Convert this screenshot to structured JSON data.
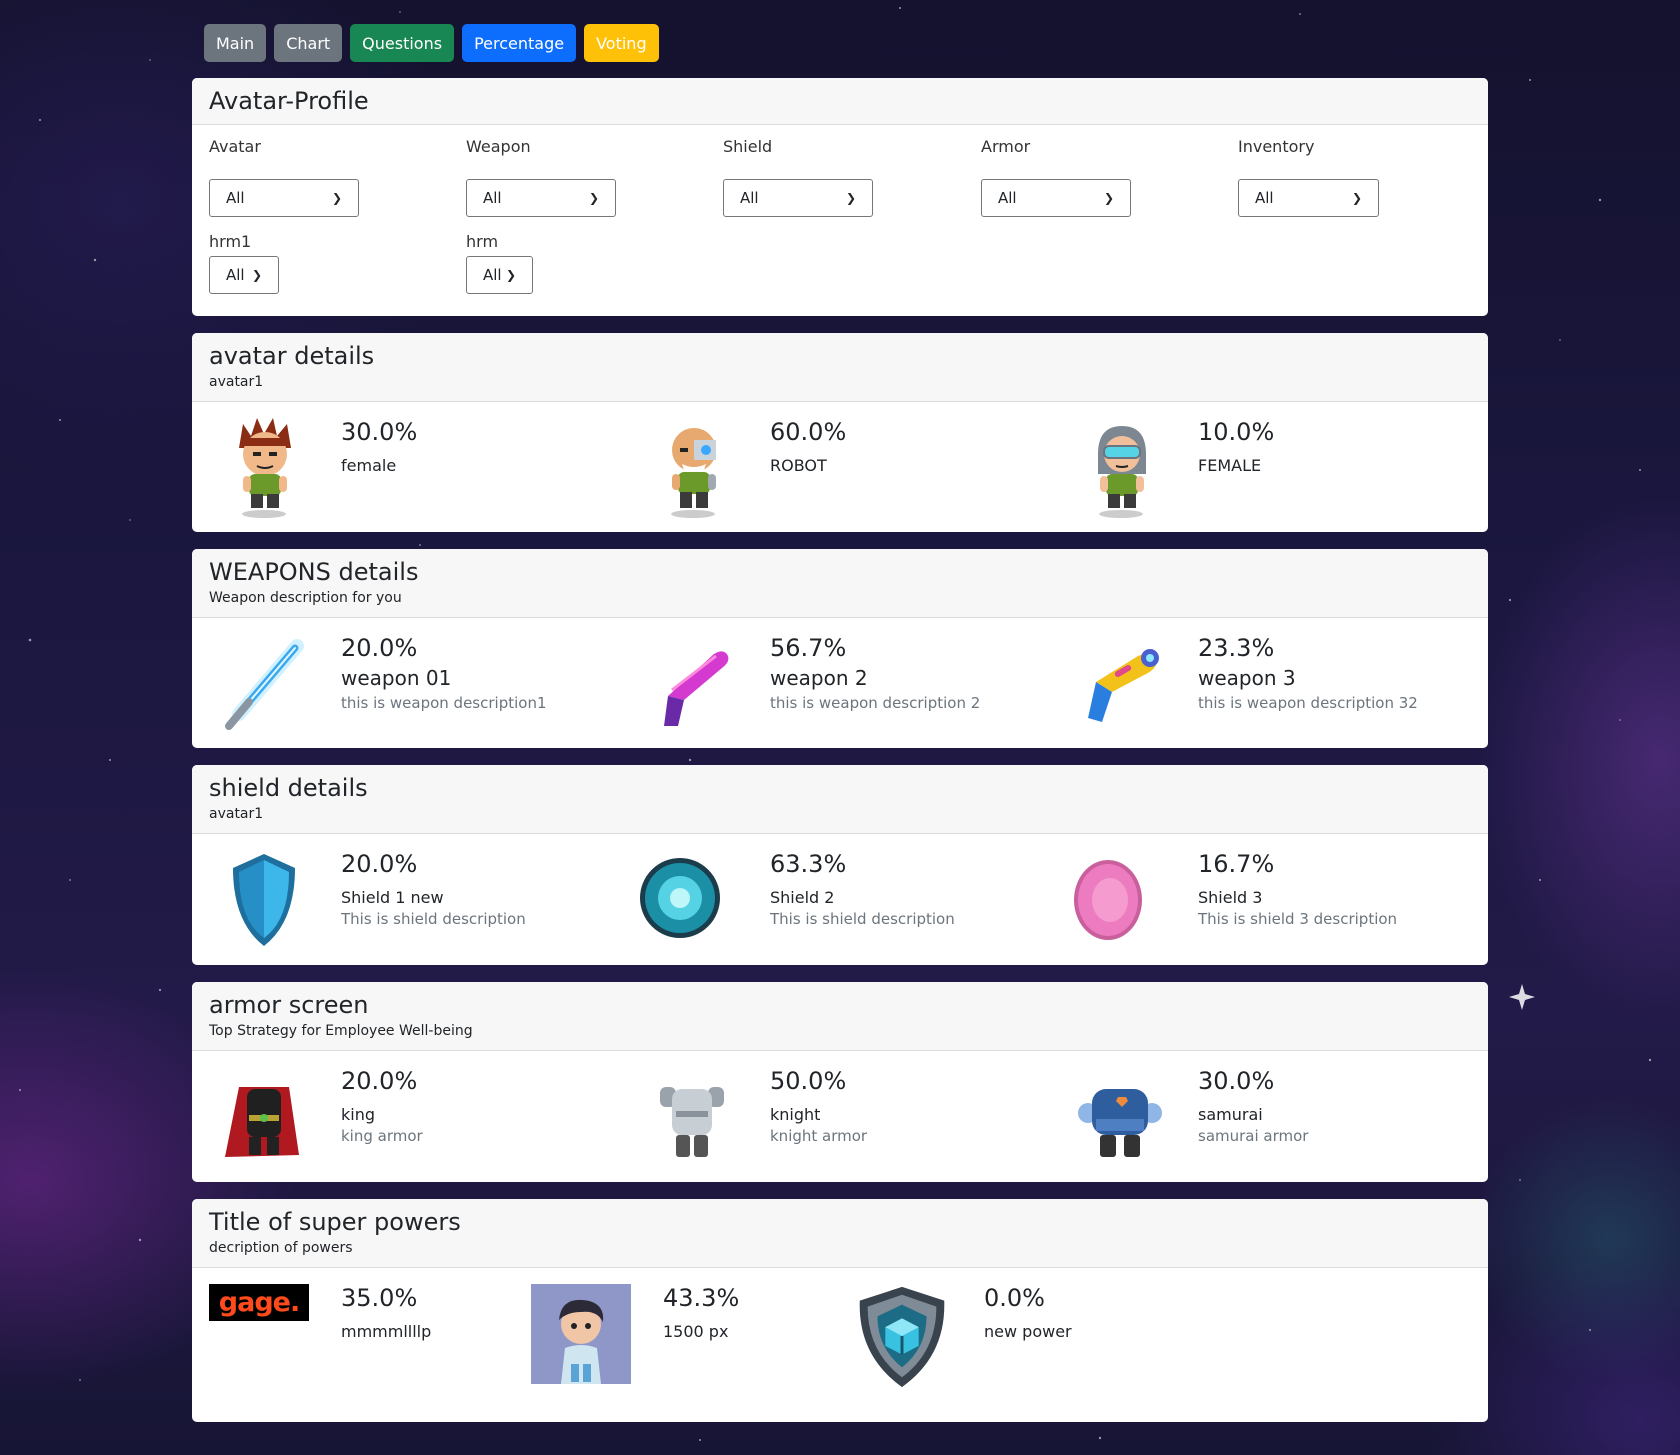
{
  "nav": {
    "main": "Main",
    "chart": "Chart",
    "questions": "Questions",
    "percentage": "Percentage",
    "voting": "Voting"
  },
  "profile": {
    "title": "Avatar-Profile",
    "filters": [
      {
        "label": "Avatar",
        "value": "All"
      },
      {
        "label": "Weapon",
        "value": "All"
      },
      {
        "label": "Shield",
        "value": "All"
      },
      {
        "label": "Armor",
        "value": "All"
      },
      {
        "label": "Inventory",
        "value": "All"
      },
      {
        "label": "hrm1",
        "value": "All"
      },
      {
        "label": "hrm",
        "value": "All"
      }
    ]
  },
  "avatar": {
    "title": "avatar details",
    "subtitle": "avatar1",
    "items": [
      {
        "pct": "30.0%",
        "name": "female",
        "icon": "spiky-hair-boy-avatar-icon"
      },
      {
        "pct": "60.0%",
        "name": "ROBOT",
        "icon": "bald-cyborg-avatar-icon"
      },
      {
        "pct": "10.0%",
        "name": "FEMALE",
        "icon": "goggles-girl-avatar-icon"
      }
    ]
  },
  "weapons": {
    "title": "WEAPONS details",
    "subtitle": "Weapon description for you",
    "items": [
      {
        "pct": "20.0%",
        "name": "weapon 01",
        "desc": "this is weapon description1",
        "icon": "light-saber-icon"
      },
      {
        "pct": "56.7%",
        "name": "weapon 2",
        "desc": "this is weapon description 2",
        "icon": "purple-blaster-icon"
      },
      {
        "pct": "23.3%",
        "name": "weapon 3",
        "desc": "this is weapon description 32",
        "icon": "ray-gun-icon"
      }
    ]
  },
  "shield": {
    "title": "shield details",
    "subtitle": "avatar1",
    "items": [
      {
        "pct": "20.0%",
        "name": "Shield 1 new",
        "desc": "This is shield description",
        "icon": "blue-shield-icon"
      },
      {
        "pct": "63.3%",
        "name": "Shield 2",
        "desc": "This is shield description",
        "icon": "energy-orb-shield-icon"
      },
      {
        "pct": "16.7%",
        "name": "Shield 3",
        "desc": "This is shield 3 description",
        "icon": "pink-disc-shield-icon"
      }
    ]
  },
  "armor": {
    "title": "armor screen",
    "subtitle": "Top Strategy for Employee Well-being",
    "items": [
      {
        "pct": "20.0%",
        "name": "king",
        "desc": "king armor",
        "icon": "king-armor-icon"
      },
      {
        "pct": "50.0%",
        "name": "knight",
        "desc": "knight armor",
        "icon": "knight-armor-icon"
      },
      {
        "pct": "30.0%",
        "name": "samurai",
        "desc": "samurai armor",
        "icon": "samurai-armor-icon"
      }
    ]
  },
  "powers": {
    "title": "Title of super powers",
    "subtitle": "decription of powers",
    "items": [
      {
        "pct": "35.0%",
        "name": "mmmmllllp",
        "icon": "gage-logo-icon",
        "logo_text": "gage."
      },
      {
        "pct": "43.3%",
        "name": "1500 px",
        "icon": "cartoon-boy-portrait-icon"
      },
      {
        "pct": "0.0%",
        "name": "new power",
        "icon": "cube-shield-badge-icon"
      }
    ]
  },
  "colors": {
    "gray": "#6c757d",
    "green": "#198754",
    "blue": "#0d6efd",
    "yellow": "#ffc107"
  }
}
